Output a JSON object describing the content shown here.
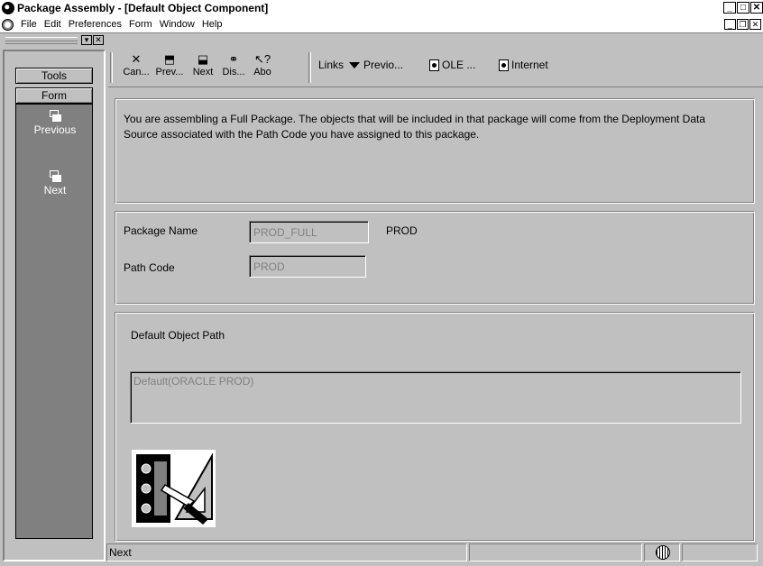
{
  "window": {
    "title": "Package Assembly - [Default Object Component]"
  },
  "menubar": {
    "items": [
      "File",
      "Edit",
      "Preferences",
      "Form",
      "Window",
      "Help"
    ]
  },
  "leftpane": {
    "tools_label": "Tools",
    "form_label": "Form",
    "items": [
      {
        "label": "Previous",
        "icon": "previous-icon"
      },
      {
        "label": "Next",
        "icon": "next-icon"
      }
    ]
  },
  "toolbar": {
    "buttons": [
      {
        "label": "Can...",
        "icon": "cancel-icon"
      },
      {
        "label": "Prev...",
        "icon": "previous-icon"
      },
      {
        "label": "Next",
        "icon": "next-icon"
      },
      {
        "label": "Dis...",
        "icon": "display-icon"
      },
      {
        "label": "Abo",
        "icon": "about-icon"
      }
    ],
    "links_label": "Links",
    "previo_label": "Previo...",
    "ole_label": "OLE ...",
    "internet_label": "Internet"
  },
  "main": {
    "info_text": "You are assembling a Full Package.  The objects that will be included in that package will come from the Deployment Data Source associated with the Path Code you have assigned to this package.",
    "package_name_label": "Package Name",
    "package_name_value": "PROD_FULL",
    "package_name_desc": "PROD",
    "path_code_label": "Path Code",
    "path_code_value": "PROD",
    "default_path_label": "Default Object Path",
    "default_path_value": "Default(ORACLE PROD)"
  },
  "statusbar": {
    "text": "Next"
  },
  "colors": {
    "face": "#c0c0c0",
    "shadow": "#808080",
    "highlight": "#ffffff",
    "sidebar": "#808080"
  }
}
